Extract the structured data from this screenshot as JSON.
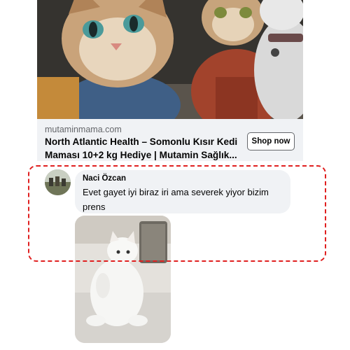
{
  "ad": {
    "domain": "mutaminmama.com",
    "title": "North Atlantic Health – Somonlu Kısır Kedi Maması 10+2 kg Hediye | Mutamin Sağlık...",
    "button_label": "Shop now"
  },
  "comment": {
    "author": "Naci Özcan",
    "text": "Evet gayet iyi biraz iri ama severek yiyor bizim prens"
  },
  "colors": {
    "highlight": "#e02020",
    "bubble": "#f0f2f5",
    "text": "#050505",
    "secondary_text": "#65676b"
  }
}
